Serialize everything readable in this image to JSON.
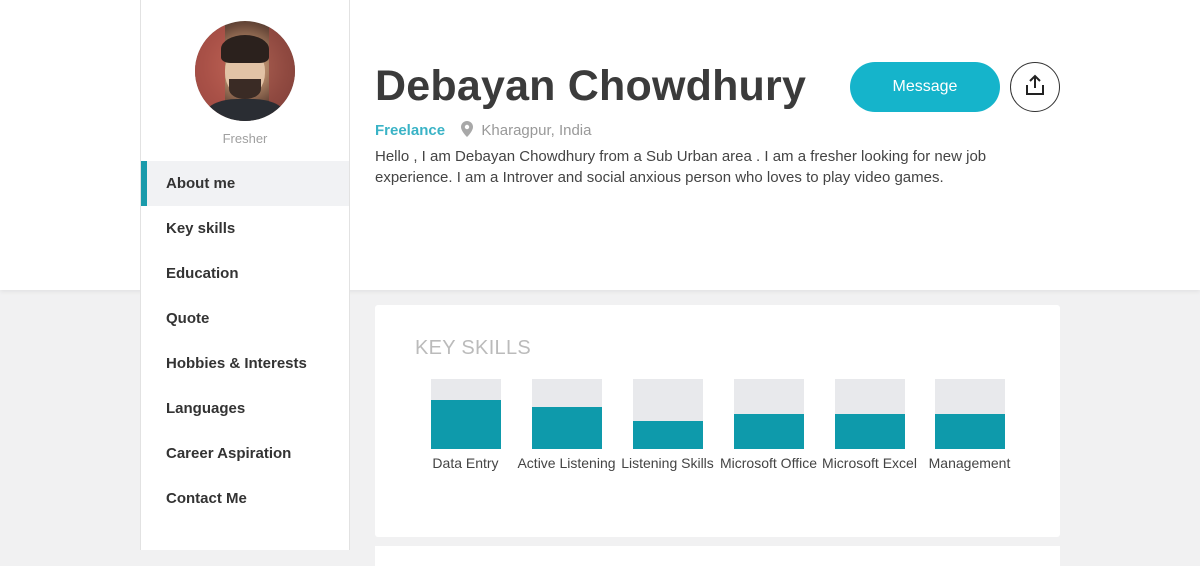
{
  "profile": {
    "role": "Fresher",
    "name": "Debayan Chowdhury",
    "job_type": "Freelance",
    "location": "Kharagpur, India",
    "bio": "Hello , I am Debayan Chowdhury from a Sub Urban area . I am a fresher looking for new job experience. I am a Introver and social anxious person who loves to play video games."
  },
  "actions": {
    "message_label": "Message"
  },
  "sidebar": {
    "items": [
      {
        "label": "About me",
        "active": true
      },
      {
        "label": "Key skills"
      },
      {
        "label": "Education"
      },
      {
        "label": "Quote"
      },
      {
        "label": "Hobbies & Interests"
      },
      {
        "label": "Languages"
      },
      {
        "label": "Career Aspiration"
      },
      {
        "label": "Contact Me"
      }
    ]
  },
  "key_skills": {
    "title": "KEY SKILLS",
    "accent_color": "#0e9aab",
    "items": [
      {
        "label": "Data Entry",
        "level": 0.7
      },
      {
        "label": "Active Listening",
        "level": 0.6
      },
      {
        "label": "Listening Skills",
        "level": 0.4
      },
      {
        "label": "Microsoft Office",
        "level": 0.5
      },
      {
        "label": "Microsoft Excel",
        "level": 0.5
      },
      {
        "label": "Management",
        "level": 0.5
      }
    ]
  },
  "icons": {
    "location": "map-pin-icon",
    "share": "share-upload-icon"
  }
}
